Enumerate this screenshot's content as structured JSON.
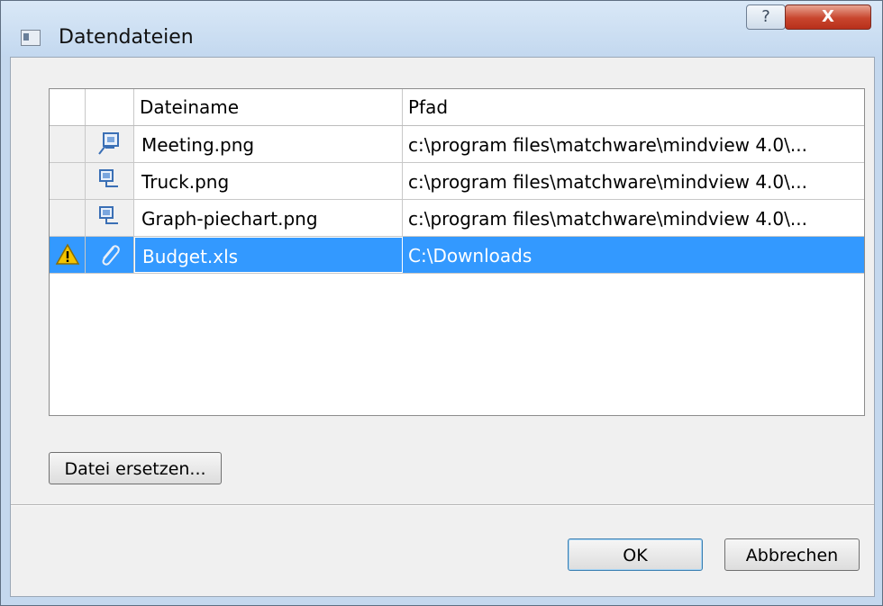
{
  "window": {
    "title": "Datendateien",
    "help_label": "?",
    "close_label": "X"
  },
  "table": {
    "columns": [
      "Dateiname",
      "Pfad"
    ],
    "rows": [
      {
        "name": "Meeting.png",
        "path": "c:\\program files\\matchware\\mindview 4.0\\...",
        "icon": "image-file-icon",
        "warning": false
      },
      {
        "name": "Truck.png",
        "path": "c:\\program files\\matchware\\mindview 4.0\\...",
        "icon": "image-file-icon",
        "warning": false
      },
      {
        "name": "Graph-piechart.png",
        "path": "c:\\program files\\matchware\\mindview 4.0\\...",
        "icon": "image-file-icon",
        "warning": false
      },
      {
        "name": "Budget.xls",
        "path": "C:\\Downloads",
        "icon": "paperclip-icon",
        "warning": true,
        "selected": true
      }
    ]
  },
  "buttons": {
    "replace": "Datei ersetzen...",
    "ok": "OK",
    "cancel": "Abbrechen"
  },
  "colors": {
    "selection": "#3399ff",
    "warning": "#f5c400"
  }
}
